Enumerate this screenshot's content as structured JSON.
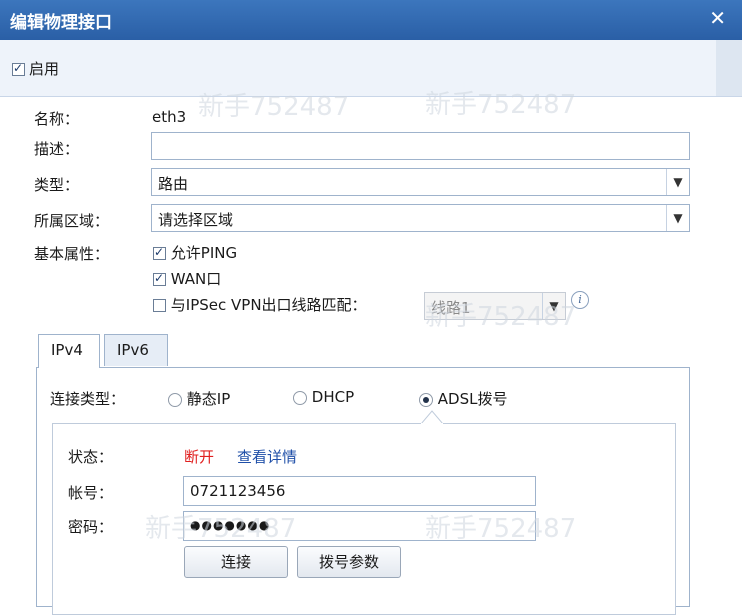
{
  "window": {
    "title": "编辑物理接口",
    "close_glyph": "✕"
  },
  "enable": {
    "label": "启用",
    "checked": true
  },
  "form": {
    "name_label": "名称：",
    "name_value": "eth3",
    "desc_label": "描述：",
    "desc_value": "",
    "type_label": "类型：",
    "type_value": "路由",
    "zone_label": "所属区域：",
    "zone_value": "请选择区域",
    "basic_label": "基本属性：",
    "allow_ping": {
      "label": "允许PING",
      "checked": true
    },
    "wan": {
      "label": "WAN口",
      "checked": true
    },
    "ipsec_match": {
      "label": "与IPSec VPN出口线路匹配：",
      "checked": false
    },
    "line_value": "线路1",
    "info_glyph": "i"
  },
  "tabs": [
    {
      "label": "IPv4",
      "active": true
    },
    {
      "label": "IPv6",
      "active": false
    }
  ],
  "ipv4": {
    "conn_type_label": "连接类型：",
    "options": [
      {
        "label": "静态IP",
        "selected": false
      },
      {
        "label": "DHCP",
        "selected": false
      },
      {
        "label": "ADSL拨号",
        "selected": true
      }
    ],
    "status_label": "状态：",
    "status_value": "断开",
    "view_detail": "查看详情",
    "account_label": "帐号：",
    "account_value": "0721123456",
    "password_label": "密码：",
    "password_value": "●●●●●●●",
    "connect_button": "连接",
    "dial_params_button": "拨号参数"
  },
  "colors": {
    "title_bar": "#2f66ad",
    "status_red": "#e02020",
    "link_blue": "#1f4fa8"
  },
  "watermark": "新手752487"
}
